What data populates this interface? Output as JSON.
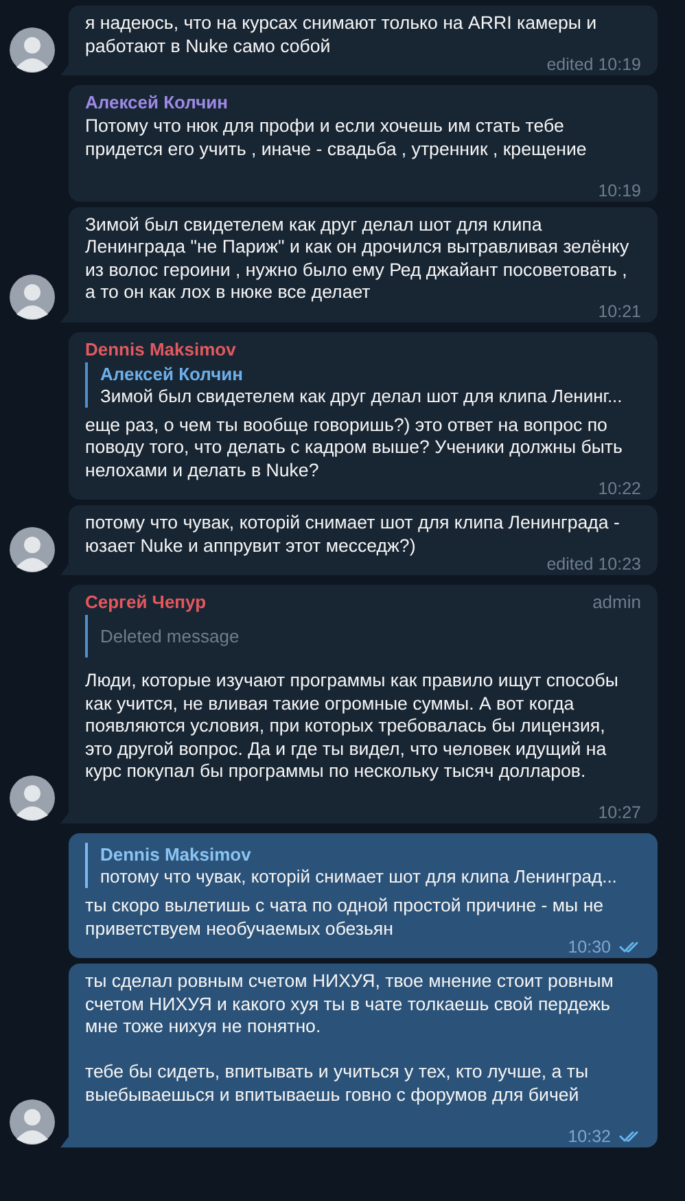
{
  "messages": [
    {
      "kind": "incoming",
      "avatar": true,
      "text": "я надеюсь, что на курсах снимают только на ARRI камеры и\nработают в Nuke само собой",
      "time": "edited 10:19"
    },
    {
      "kind": "incoming",
      "avatar": false,
      "author": "Алексей Колчин",
      "color": "#9d8ae6",
      "text": "Потому что нюк для профи и если хочешь им стать тебе\nпридется его учить , иначе - свадьба , утренник , крещение",
      "time": "10:19"
    },
    {
      "kind": "incoming",
      "avatar": true,
      "text": "Зимой был свидетелем как друг делал шот для клипа\nЛенинграда \"не Париж\" и как он дрочился вытравливая зелёнку\nиз волос героини , нужно было ему Ред джайант посоветовать ,\nа то он как лох в нюке все делает",
      "time": "10:21"
    },
    {
      "kind": "incoming",
      "avatar": false,
      "author": "Dennis Maksimov",
      "color": "#e05a5f",
      "reply": {
        "deleted": false,
        "author": "Алексей Колчин",
        "text": "Зимой был свидетелем как друг делал шот для клипа Ленинг..."
      },
      "text": "еще раз, о чем ты вообще говоришь?) это ответ на вопрос по\nповоду того, что делать с кадром выше? Ученики должны быть\nнелохами и делать в Nuke?",
      "time": "10:22"
    },
    {
      "kind": "incoming",
      "avatar": true,
      "text": "потому что чувак, которій снимает шот для клипа Ленинграда -\nюзает Nuke и аппрувит этот месседж?)",
      "time": "edited 10:23"
    },
    {
      "kind": "incoming",
      "avatar": true,
      "author": "Сергей Чепур",
      "color": "#e5585d",
      "badge": "admin",
      "reply": {
        "deleted": true,
        "text": "Deleted message"
      },
      "text": "Люди, которые изучают программы как правило ищут способы\nкак учится, не вливая такие огромные суммы. А вот когда\nпоявляются условия, при которых требовалась бы лицензия,\nэто другой вопрос. Да и где ты видел, что человек идущий на\nкурс покупал бы программы по нескольку тысяч долларов.",
      "time": "10:27"
    },
    {
      "kind": "outgoing",
      "avatar": false,
      "reply": {
        "deleted": false,
        "author": "Dennis Maksimov",
        "text": "потому что чувак, которій снимает шот для клипа Ленинград..."
      },
      "text": "ты скоро вылетишь с чата по одной простой причине - мы не\nприветствуем необучаемых обезьян",
      "time": "10:30",
      "read": true
    },
    {
      "kind": "outgoing",
      "avatar": true,
      "text": "ты сделал ровным счетом НИХУЯ, твое мнение стоит ровным\nсчетом НИХУЯ и какого хуя ты в чате толкаешь свой пердежь\nмне тоже нихуя не понятно.\n\nтебе бы сидеть, впитывать и учиться у тех, кто лучше, а ты\nвыебываешься и впитываешь говно с форумов для бичей",
      "time": "10:32",
      "read": true
    }
  ]
}
